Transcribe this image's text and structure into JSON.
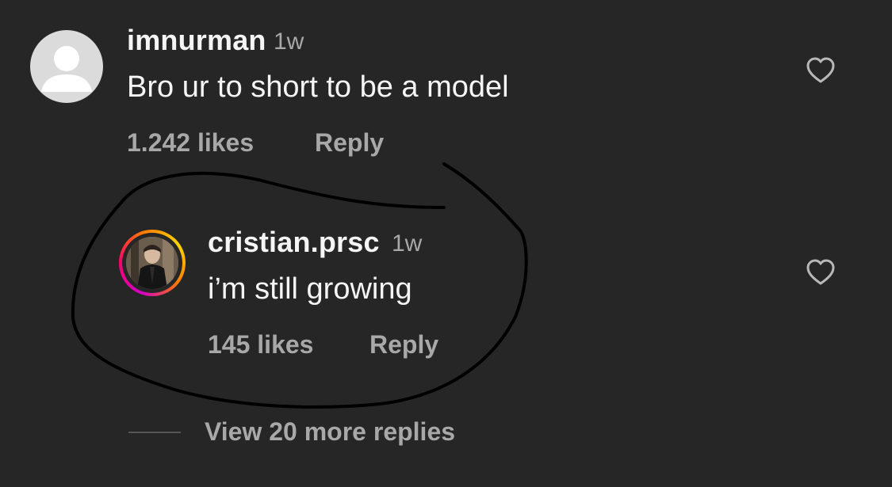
{
  "comments": [
    {
      "username": "imnurman",
      "time": "1w",
      "text": "Bro ur to short to be a model",
      "likes": "1.242 likes",
      "reply_label": "Reply",
      "avatar_icon": "default-user-avatar",
      "like_icon": "heart-outline-icon"
    },
    {
      "username": "cristian.prsc",
      "time": "1w",
      "text": "i’m still growing",
      "likes": "145 likes",
      "reply_label": "Reply",
      "avatar_icon": "story-ring-avatar",
      "like_icon": "heart-outline-icon"
    }
  ],
  "view_more_label": "View 20 more replies",
  "colors": {
    "background": "#262626",
    "primary_text": "#f5f5f5",
    "secondary_text": "#a8a8a8",
    "annotation_stroke": "#000000"
  },
  "annotation": "hand-drawn-circle"
}
